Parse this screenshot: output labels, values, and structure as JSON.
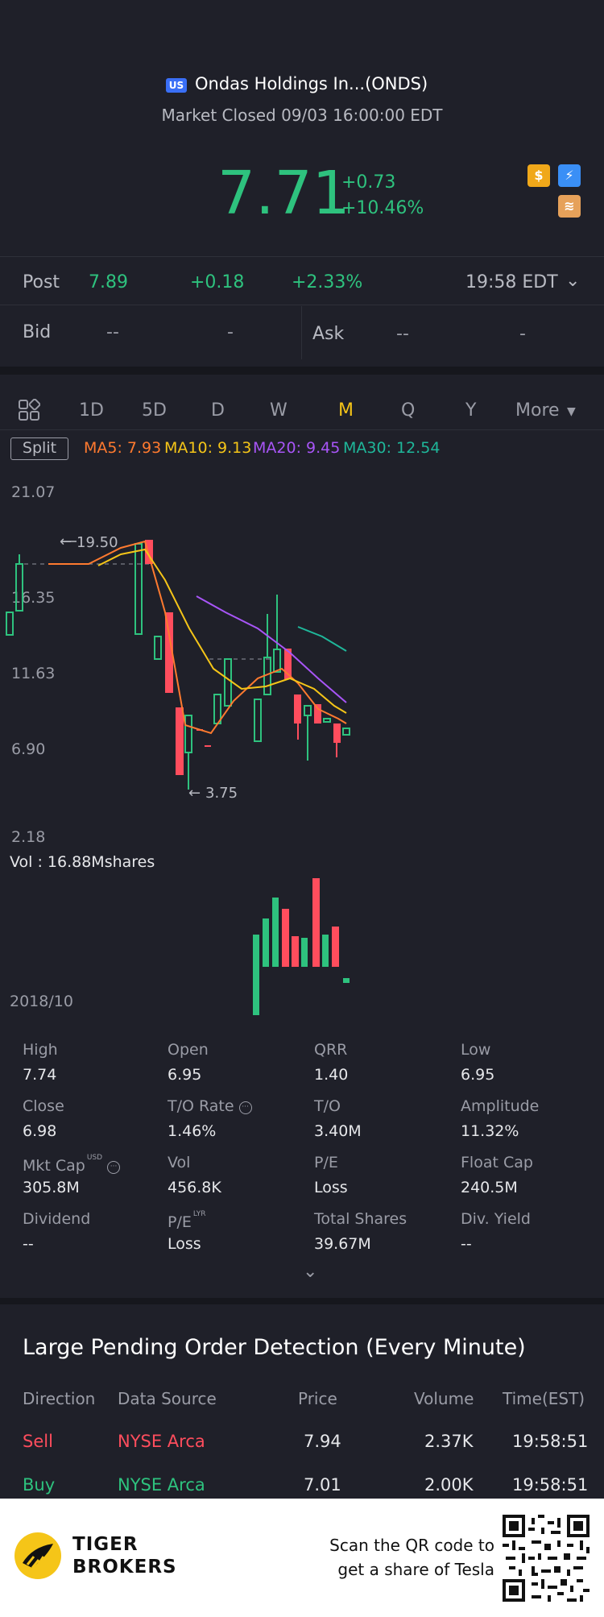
{
  "header": {
    "market_badge": "US",
    "stock_name": "Ondas Holdings In...(ONDS)",
    "market_status": "Market Closed 09/03 16:00:00 EDT",
    "price": "7.71",
    "change": "+0.73",
    "change_pct": "+10.46%",
    "accent_green": "#2ec27e",
    "accent_red": "#ff4d5d",
    "icons": [
      "dollar-icon",
      "lightning-icon",
      "stack-icon"
    ]
  },
  "post": {
    "label": "Post",
    "price": "7.89",
    "change": "+0.18",
    "change_pct": "+2.33%",
    "time": "19:58 EDT"
  },
  "quote": {
    "bid_label": "Bid",
    "bid_price": "--",
    "bid_size": "-",
    "ask_label": "Ask",
    "ask_price": "--",
    "ask_size": "-"
  },
  "tabs": {
    "items": [
      "1D",
      "5D",
      "D",
      "W",
      "M",
      "Q",
      "Y",
      "More"
    ],
    "active": "M"
  },
  "ma": {
    "split_label": "Split",
    "ma5": "MA5: 7.93",
    "ma10": "MA10: 9.13",
    "ma20": "MA20: 9.45",
    "ma30": "MA30: 12.54",
    "colors": {
      "ma5": "#ff7a2f",
      "ma10": "#f5c518",
      "ma20": "#a855f7",
      "ma30": "#1fb79a"
    }
  },
  "chart": {
    "y_ticks": [
      "21.07",
      "16.35",
      "11.63",
      "6.90",
      "2.18"
    ],
    "high_marker": "19.50",
    "low_marker": "3.75",
    "volume_label": "Vol  : 16.88Mshares",
    "start_date": "2018/10"
  },
  "stats": [
    {
      "label": "High",
      "value": "7.74"
    },
    {
      "label": "Open",
      "value": "6.95"
    },
    {
      "label": "QRR",
      "value": "1.40"
    },
    {
      "label": "Low",
      "value": "6.95"
    },
    {
      "label": "Close",
      "value": "6.98"
    },
    {
      "label": "T/O Rate",
      "value": "1.46%"
    },
    {
      "label": "T/O",
      "value": "3.40M"
    },
    {
      "label": "Amplitude",
      "value": "11.32%"
    },
    {
      "label": "Mkt Cap",
      "value": "305.8M"
    },
    {
      "label": "Vol",
      "value": "456.8K"
    },
    {
      "label": "P/E",
      "value": "Loss"
    },
    {
      "label": "Float Cap",
      "value": "240.5M"
    },
    {
      "label": "Dividend",
      "value": "--"
    },
    {
      "label": "P/E",
      "value": "Loss"
    },
    {
      "label": "Total Shares",
      "value": "39.67M"
    },
    {
      "label": "Div. Yield",
      "value": "--"
    }
  ],
  "stat_superscripts": {
    "mkt_cap": "USD",
    "pe_lyr": "LYR"
  },
  "orders": {
    "title": "Large Pending Order Detection (Every Minute)",
    "headers": [
      "Direction",
      "Data Source",
      "Price",
      "Volume",
      "Time(EST)"
    ],
    "rows": [
      {
        "direction": "Sell",
        "source": "NYSE Arca",
        "price": "7.94",
        "volume": "2.37K",
        "time": "19:58:51"
      },
      {
        "direction": "Buy",
        "source": "NYSE Arca",
        "price": "7.01",
        "volume": "2.00K",
        "time": "19:58:51"
      }
    ]
  },
  "footer": {
    "brand_line1": "TIGER",
    "brand_line2": "BROKERS",
    "scan_line1": "Scan the QR code to",
    "scan_line2": "get a share of Tesla"
  }
}
